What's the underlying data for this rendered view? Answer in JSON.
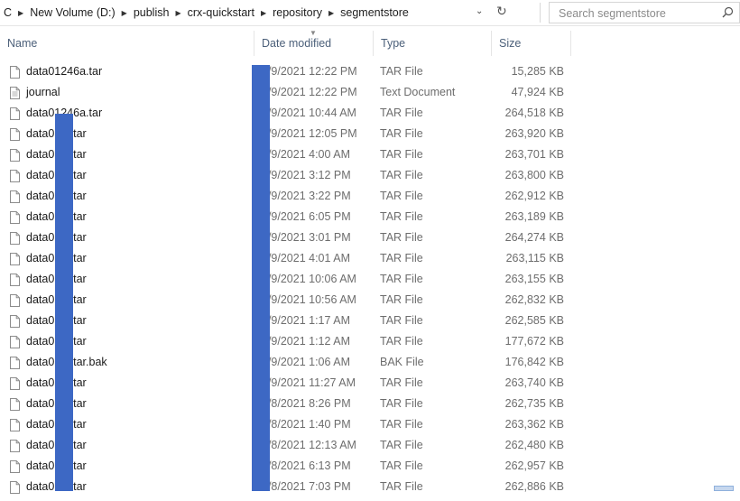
{
  "address_bar": {
    "crumbs": [
      "C",
      "New Volume (D:)",
      "publish",
      "crx-quickstart",
      "repository",
      "segmentstore"
    ],
    "search_placeholder": "Search segmentstore"
  },
  "columns": {
    "name": "Name",
    "date": "Date modified",
    "type": "Type",
    "size": "Size"
  },
  "files": [
    {
      "name": "data01246a.tar",
      "date": "7/9/2021 12:22 PM",
      "type": "TAR File",
      "size": "15,285 KB"
    },
    {
      "name": "journal",
      "date": "7/9/2021 12:22 PM",
      "type": "Text Document",
      "size": "47,924 KB"
    },
    {
      "name": "data01246a.tar",
      "date": "7/9/2021 10:44 AM",
      "type": "TAR File",
      "size": "264,518 KB"
    },
    {
      "name": "data0 4a.tar",
      "date": "7/9/2021 12:05 PM",
      "type": "TAR File",
      "size": "263,920 KB"
    },
    {
      "name": "data0 3a.tar",
      "date": "7/9/2021 4:00 AM",
      "type": "TAR File",
      "size": "263,701 KB"
    },
    {
      "name": "data0 2a.tar",
      "date": "7/9/2021 3:12 PM",
      "type": "TAR File",
      "size": "263,800 KB"
    },
    {
      "name": "data0 1a.tar",
      "date": "7/9/2021 3:22 PM",
      "type": "TAR File",
      "size": "262,912 KB"
    },
    {
      "name": "data0 0a.tar",
      "date": "7/9/2021 6:05 PM",
      "type": "TAR File",
      "size": "263,189 KB"
    },
    {
      "name": "data0 9a.tar",
      "date": "7/9/2021 3:01 PM",
      "type": "TAR File",
      "size": "264,274 KB"
    },
    {
      "name": "data0 8a.tar",
      "date": "7/9/2021 4:01 AM",
      "type": "TAR File",
      "size": "263,115 KB"
    },
    {
      "name": "data0 7a.tar",
      "date": "7/9/2021 10:06 AM",
      "type": "TAR File",
      "size": "263,155 KB"
    },
    {
      "name": "data0 6a.tar",
      "date": "7/9/2021 10:56 AM",
      "type": "TAR File",
      "size": "262,832 KB"
    },
    {
      "name": "data0 5a.tar",
      "date": "7/9/2021 1:17 AM",
      "type": "TAR File",
      "size": "262,585 KB"
    },
    {
      "name": "data0 4a.tar",
      "date": "7/9/2021 1:12 AM",
      "type": "TAR File",
      "size": "177,672 KB"
    },
    {
      "name": "data0 4a.tar.bak",
      "date": "7/9/2021 1:06 AM",
      "type": "BAK File",
      "size": "176,842 KB"
    },
    {
      "name": "data0 3a.tar",
      "date": "7/9/2021 11:27 AM",
      "type": "TAR File",
      "size": "263,740 KB"
    },
    {
      "name": "data0 2a.tar",
      "date": "7/8/2021 8:26 PM",
      "type": "TAR File",
      "size": "262,735 KB"
    },
    {
      "name": "data0 1a.tar",
      "date": "7/8/2021 1:40 PM",
      "type": "TAR File",
      "size": "263,362 KB"
    },
    {
      "name": "data0 0a.tar",
      "date": "7/8/2021 12:13 AM",
      "type": "TAR File",
      "size": "262,480 KB"
    },
    {
      "name": "data0 9a.tar",
      "date": "7/8/2021 6:13 PM",
      "type": "TAR File",
      "size": "262,957 KB"
    },
    {
      "name": "data0 8a.tar",
      "date": "7/8/2021 7:03 PM",
      "type": "TAR File",
      "size": "262,886 KB"
    }
  ]
}
